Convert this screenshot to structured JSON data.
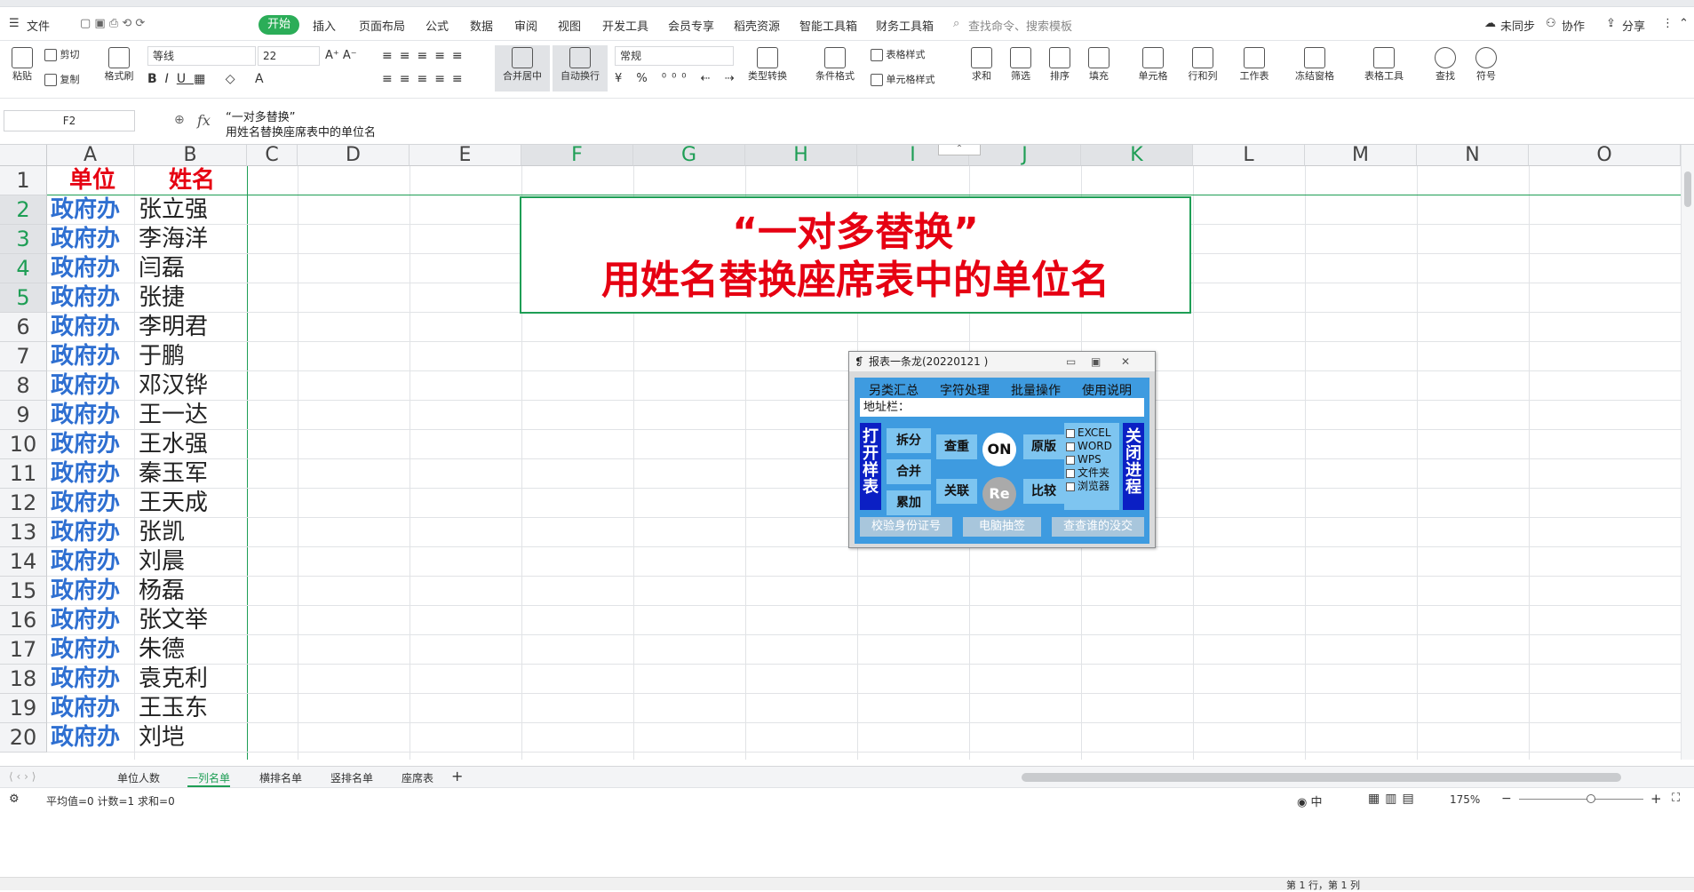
{
  "menu": {
    "file": "文件",
    "start": "开始",
    "tabs": [
      "插入",
      "页面布局",
      "公式",
      "数据",
      "审阅",
      "视图",
      "开发工具",
      "会员专享",
      "稻壳资源",
      "智能工具箱",
      "财务工具箱"
    ],
    "search": "查找命令、搜索模板",
    "sync": "未同步",
    "collab": "协作",
    "share": "分享"
  },
  "ribbon": {
    "paste": "粘贴",
    "cut": "剪切",
    "copy": "复制",
    "format_painter": "格式刷",
    "font_name": "等线",
    "font_size": "22",
    "merge": "合并居中",
    "wrap": "自动换行",
    "number_format": "常规",
    "convert": "类型转换",
    "cond_format": "条件格式",
    "table_style": "表格样式",
    "cell_style": "单元格样式",
    "sum": "求和",
    "filter": "筛选",
    "sort": "排序",
    "fill": "填充",
    "cell": "单元格",
    "rowcol": "行和列",
    "worksheet": "工作表",
    "freeze": "冻结窗格",
    "table_tools": "表格工具",
    "find": "查找",
    "symbol": "符号"
  },
  "formula_bar": {
    "name_box": "F2",
    "fx": "fx",
    "line1": "“一对多替换”",
    "line2": "用姓名替换座席表中的单位名"
  },
  "columns": [
    "A",
    "B",
    "C",
    "D",
    "E",
    "F",
    "G",
    "H",
    "I",
    "J",
    "K",
    "L",
    "M",
    "N",
    "O"
  ],
  "header_row": {
    "unit": "单位",
    "name": "姓名"
  },
  "rows": [
    {
      "num": "1"
    },
    {
      "num": "2",
      "unit": "政府办",
      "name": "张立强"
    },
    {
      "num": "3",
      "unit": "政府办",
      "name": "李海洋"
    },
    {
      "num": "4",
      "unit": "政府办",
      "name": "闫磊"
    },
    {
      "num": "5",
      "unit": "政府办",
      "name": "张捷"
    },
    {
      "num": "6",
      "unit": "政府办",
      "name": "李明君"
    },
    {
      "num": "7",
      "unit": "政府办",
      "name": "于鹏"
    },
    {
      "num": "8",
      "unit": "政府办",
      "name": "邓汉铧"
    },
    {
      "num": "9",
      "unit": "政府办",
      "name": "王一达"
    },
    {
      "num": "10",
      "unit": "政府办",
      "name": "王水强"
    },
    {
      "num": "11",
      "unit": "政府办",
      "name": "秦玉军"
    },
    {
      "num": "12",
      "unit": "政府办",
      "name": "王天成"
    },
    {
      "num": "13",
      "unit": "政府办",
      "name": "张凯"
    },
    {
      "num": "14",
      "unit": "政府办",
      "name": "刘晨"
    },
    {
      "num": "15",
      "unit": "政府办",
      "name": "杨磊"
    },
    {
      "num": "16",
      "unit": "政府办",
      "name": "张文举"
    },
    {
      "num": "17",
      "unit": "政府办",
      "name": "朱德"
    },
    {
      "num": "18",
      "unit": "政府办",
      "name": "袁克利"
    },
    {
      "num": "19",
      "unit": "政府办",
      "name": "王玉东"
    },
    {
      "num": "20",
      "unit": "政府办",
      "name": "刘垲"
    }
  ],
  "merged_cell": {
    "line1": "“一对多替换”",
    "line2": "用姓名替换座席表中的单位名"
  },
  "panel": {
    "title": "报表一条龙(20220121 )",
    "menu": [
      "另类汇总",
      "字符处理",
      "批量操作",
      "使用说明"
    ],
    "address_label": "地址栏：",
    "open_sample": "打开样表",
    "close_process": "关闭进程",
    "split": "拆分",
    "merge": "合并",
    "accumulate": "累加",
    "dedupe": "查重",
    "link": "关联",
    "on": "ON",
    "re": "Re",
    "original": "原版",
    "compare": "比较",
    "checks": [
      "EXCEL",
      "WORD",
      "WPS",
      "文件夹",
      "浏览器"
    ],
    "bottom": [
      "校验身份证号",
      "电脑抽签",
      "查查谁的没交"
    ]
  },
  "sheet_tabs": [
    "单位人数",
    "一列名单",
    "横排名单",
    "竖排名单",
    "座席表"
  ],
  "active_tab": "一列名单",
  "status": {
    "stats": "平均值=0  计数=1  求和=0",
    "zoom": "175%"
  },
  "bottom_status": "第 1 行，第 1 列",
  "colors": {
    "green": "#1e9e55",
    "red": "#e60012",
    "blue_text": "#2e6fd1",
    "panel_blue": "#3e9be0",
    "panel_dark": "#0b1fc4"
  }
}
